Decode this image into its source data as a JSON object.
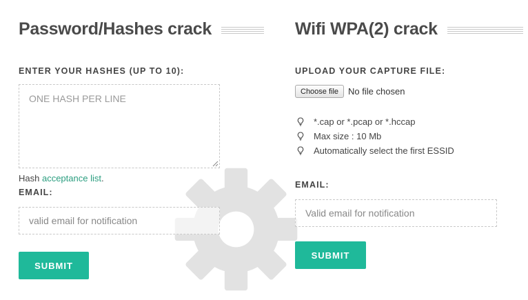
{
  "hashes_panel": {
    "title": "Password/Hashes crack",
    "hashes_label": "ENTER YOUR HASHES (UP TO 10):",
    "hashes_placeholder": "ONE HASH PER LINE",
    "hash_note_prefix": "Hash ",
    "hash_note_link": "acceptance list",
    "hash_note_suffix": ".",
    "email_label": "EMAIL:",
    "email_placeholder": "valid email for notification",
    "submit_label": "SUBMIT"
  },
  "wifi_panel": {
    "title": "Wifi WPA(2) crack",
    "upload_label": "UPLOAD YOUR CAPTURE FILE:",
    "choose_file_label": "Choose file",
    "file_status": "No file chosen",
    "tips": [
      {
        "icon": "lightbulb-icon",
        "text": "*.cap or *.pcap or *.hccap"
      },
      {
        "icon": "lightbulb-icon",
        "text": "Max size : 10 Mb"
      },
      {
        "icon": "lightbulb-icon",
        "text": "Automatically select the first ESSID"
      }
    ],
    "email_label": "EMAIL:",
    "email_placeholder": "Valid email for notification",
    "submit_label": "SUBMIT"
  },
  "colors": {
    "accent": "#1fb99a",
    "link": "#2a9d7f",
    "title": "#4a4a4a",
    "gear": "#e2e2e2"
  }
}
